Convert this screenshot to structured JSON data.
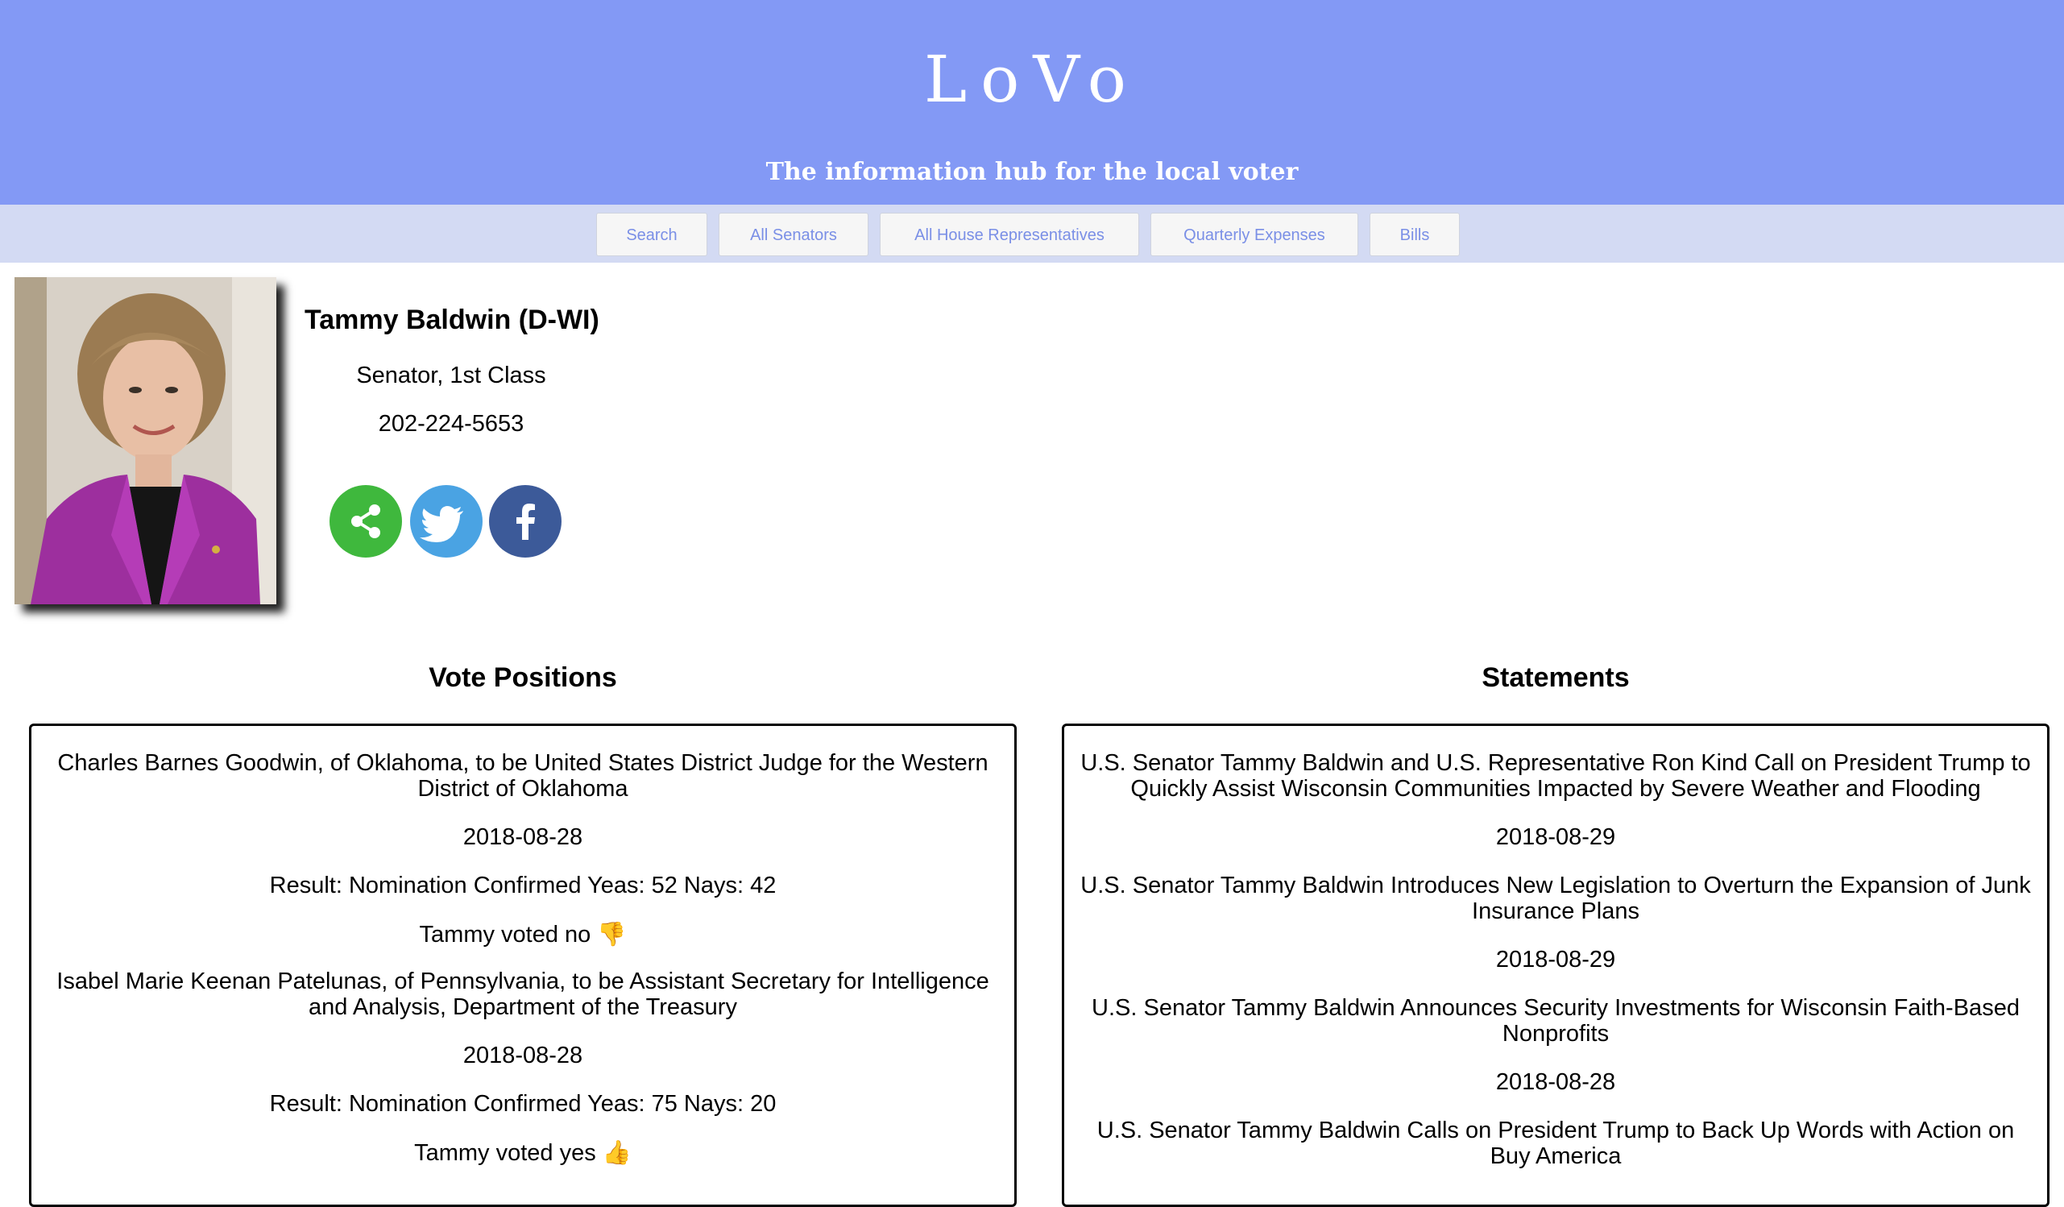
{
  "header": {
    "brand": "LoVo",
    "tagline": "The information hub for the local voter"
  },
  "nav": {
    "items": [
      {
        "label": "Search"
      },
      {
        "label": "All Senators"
      },
      {
        "label": "All House Representatives"
      },
      {
        "label": "Quarterly Expenses"
      },
      {
        "label": "Bills"
      }
    ]
  },
  "profile": {
    "name": "Tammy Baldwin (D-WI)",
    "role": "Senator, 1st Class",
    "phone": "202-224-5653",
    "social": [
      {
        "icon": "share-icon",
        "color": "#3fb83d"
      },
      {
        "icon": "twitter-icon",
        "color": "#4aa3e3"
      },
      {
        "icon": "facebook-icon",
        "color": "#3c5a99"
      }
    ]
  },
  "vote_positions": {
    "title": "Vote Positions",
    "items": [
      {
        "description": "Charles Barnes Goodwin, of Oklahoma, to be United States District Judge for the Western District of Oklahoma",
        "date": "2018-08-28",
        "result": "Result: Nomination Confirmed Yeas: 52 Nays: 42",
        "vote": "Tammy voted no",
        "vote_icon": "thumbs-down-icon",
        "vote_emoji": "👎"
      },
      {
        "description": "Isabel Marie Keenan Patelunas, of Pennsylvania, to be Assistant Secretary for Intelligence and Analysis, Department of the Treasury",
        "date": "2018-08-28",
        "result": "Result: Nomination Confirmed Yeas: 75 Nays: 20",
        "vote": "Tammy voted yes",
        "vote_icon": "thumbs-up-icon",
        "vote_emoji": "👍"
      }
    ]
  },
  "statements": {
    "title": "Statements",
    "items": [
      {
        "title": "U.S. Senator Tammy Baldwin and U.S. Representative Ron Kind Call on President Trump to Quickly Assist Wisconsin Communities Impacted by Severe Weather and Flooding",
        "date": "2018-08-29"
      },
      {
        "title": "U.S. Senator Tammy Baldwin Introduces New Legislation to Overturn the Expansion of Junk Insurance Plans",
        "date": "2018-08-29"
      },
      {
        "title": "U.S. Senator Tammy Baldwin Announces Security Investments for Wisconsin Faith-Based Nonprofits",
        "date": "2018-08-28"
      },
      {
        "title": "U.S. Senator Tammy Baldwin Calls on President Trump to Back Up Words with Action on Buy America",
        "date": ""
      }
    ]
  }
}
